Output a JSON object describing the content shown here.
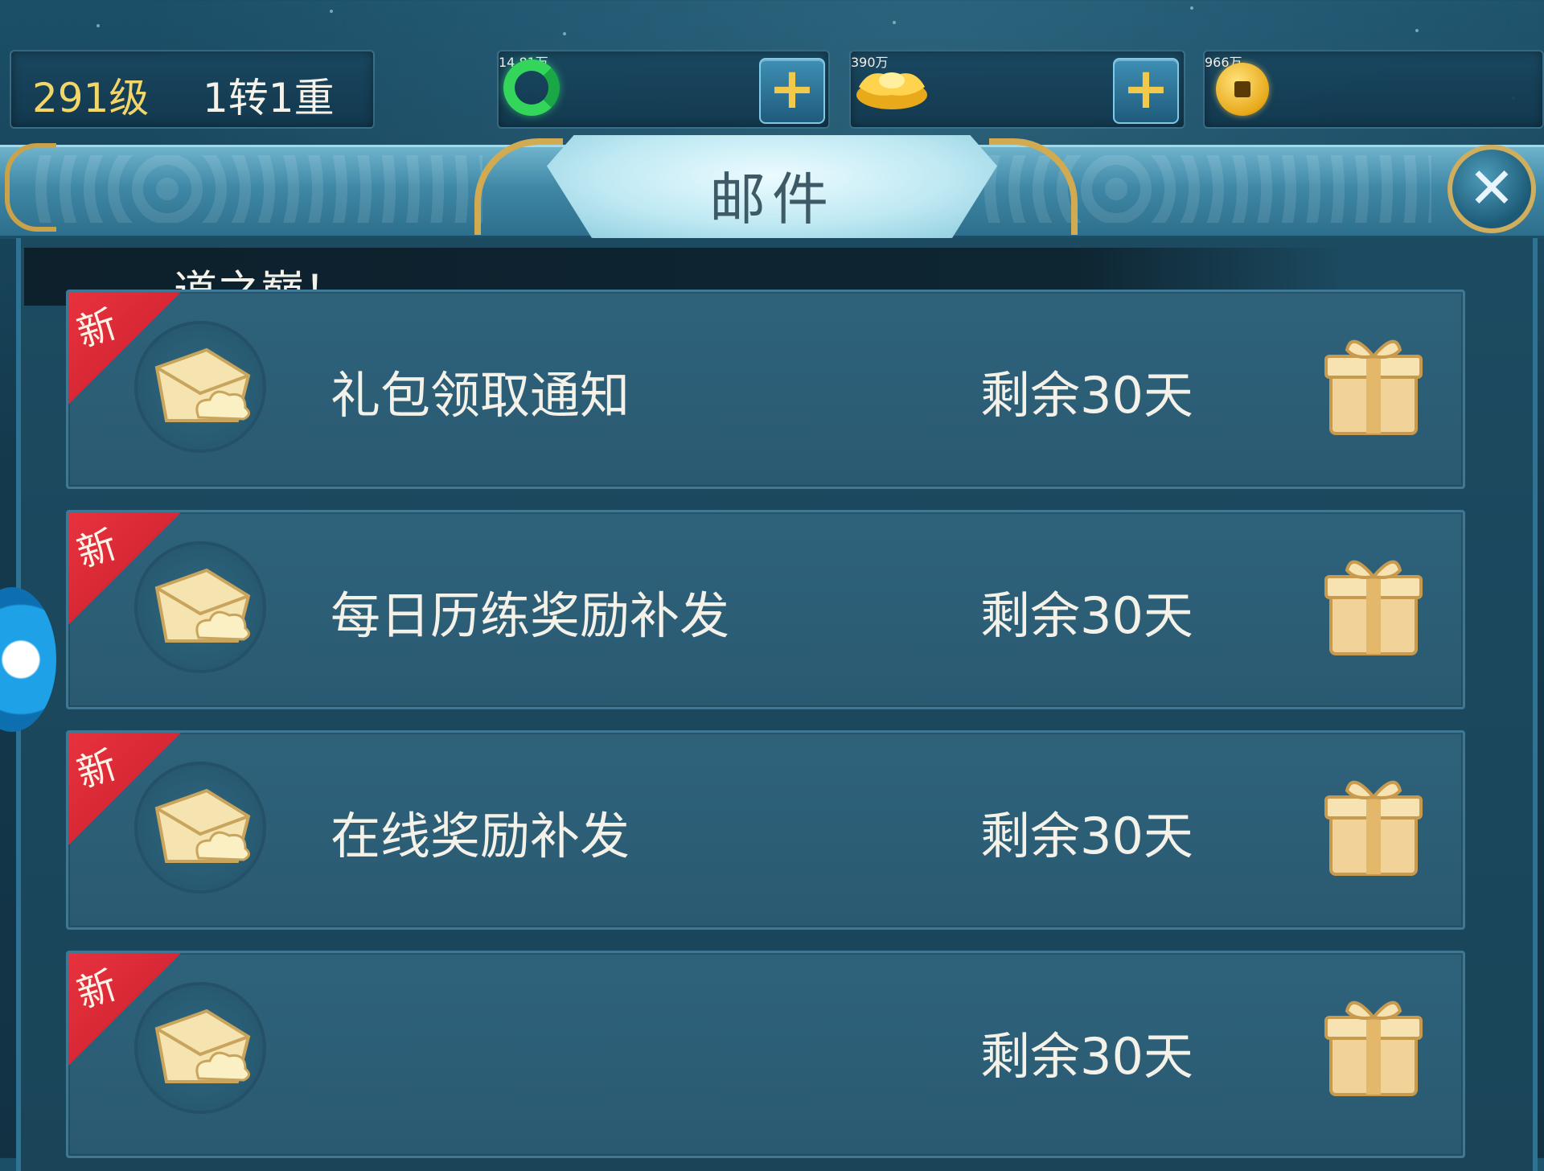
{
  "top_bar": {
    "level": "291级",
    "reincarnation": "1转1重",
    "jade": {
      "icon": "jade-ring-icon",
      "value": "14.81万"
    },
    "gold_ingot": {
      "icon": "gold-ingot-icon",
      "value": "390万"
    },
    "coins": {
      "icon": "copper-coin-icon",
      "value": "966万"
    },
    "plus_label": "+"
  },
  "panel": {
    "title": "邮件",
    "close_label": "✕"
  },
  "marquee": {
    "text": "道之巅！"
  },
  "mails": [
    {
      "tag": "新",
      "subject": "礼包领取通知",
      "expire": "剩余30天"
    },
    {
      "tag": "新",
      "subject": "每日历练奖励补发",
      "expire": "剩余30天"
    },
    {
      "tag": "新",
      "subject": "在线奖励补发",
      "expire": "剩余30天"
    },
    {
      "tag": "新",
      "subject": "",
      "expire": "剩余30天"
    }
  ],
  "colors": {
    "level_text": "#f3d66a",
    "new_tag": "#e8323e",
    "gold_trim": "#cfae5e",
    "jade": "#33d65a"
  }
}
